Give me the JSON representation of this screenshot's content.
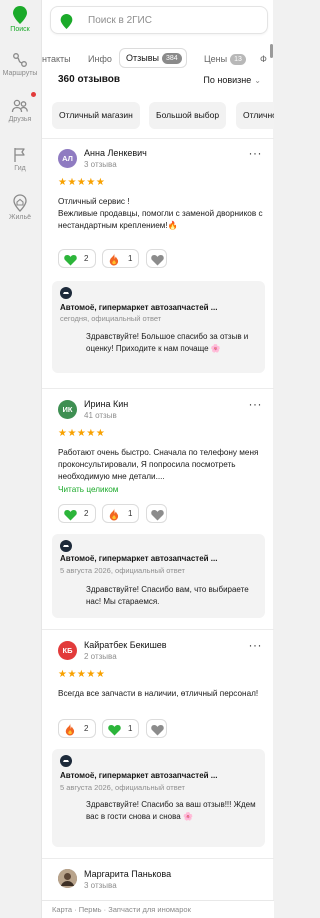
{
  "colors": {
    "brand_green": "#1baa2a",
    "star": "#f8a100",
    "notification": "#e23b3b"
  },
  "rail": {
    "items": [
      {
        "label": "Поиск",
        "icon": "pin-icon",
        "active": true
      },
      {
        "label": "Маршруты",
        "icon": "route-icon"
      },
      {
        "label": "Друзья",
        "icon": "friends-icon",
        "has_dot": true
      },
      {
        "label": "Гид",
        "icon": "flag-icon"
      },
      {
        "label": "Жильё",
        "icon": "housing-icon"
      }
    ]
  },
  "search": {
    "placeholder": "Поиск в 2ГИС"
  },
  "tabs": {
    "items": [
      {
        "label": "нтакты"
      },
      {
        "label": "Инфо"
      },
      {
        "label": "Отзывы",
        "badge": "384",
        "active": true
      },
      {
        "label": "Цены",
        "badge": "13"
      },
      {
        "label": "Ф"
      }
    ]
  },
  "reviews_header": {
    "count": "360 отзывов",
    "sort": "По новизне"
  },
  "chips": [
    "Отличный магазин",
    "Большой выбор",
    "Отличное"
  ],
  "reviews": [
    {
      "initials": "АЛ",
      "avatar_color": "#8f7bc1",
      "name": "Анна Ленкевич",
      "reviews_count": "3 отзыва",
      "stars": "★★★★★",
      "text": "Отличный сервис !\nВежливые продавцы, помогли с заменой дворников с нестандартным креплением!🔥",
      "reactions": [
        {
          "emoji": "heart-green",
          "count": "2"
        },
        {
          "emoji": "fire",
          "count": "1"
        },
        {
          "emoji": "heart-grey"
        }
      ],
      "reply": {
        "org": "Автомоё, гипермаркет автозапчастей ...",
        "date": "сегодня, официальный ответ",
        "text": "Здравствуйте! Большое спасибо за отзыв и оценку! Приходите к нам почаще 🌸"
      }
    },
    {
      "initials": "ИК",
      "avatar_color": "#3e8f52",
      "name": "Ирина Кин",
      "reviews_count": "41 отзыв",
      "stars": "★★★★★",
      "text": "Работают очень быстро. Сначала по телефону меня проконсультировали, Я попросила посмотреть необходимую мне детали....",
      "read_more": "Читать целиком",
      "reactions": [
        {
          "emoji": "heart-green",
          "count": "2"
        },
        {
          "emoji": "fire",
          "count": "1"
        },
        {
          "emoji": "heart-grey"
        }
      ],
      "reply": {
        "org": "Автомоё, гипермаркет автозапчастей ...",
        "date": "5 августа 2026, официальный ответ",
        "text": "Здравствуйте! Спасибо вам, что выбираете нас! Мы стараемся."
      }
    },
    {
      "initials": "КБ",
      "avatar_color": "#e23b3b",
      "name": "Кайратбек Бекишев",
      "reviews_count": "2 отзыва",
      "stars": "★★★★★",
      "text": "Всегда все запчасти в наличии, өтличный персонал!",
      "reactions": [
        {
          "emoji": "fire",
          "count": "2"
        },
        {
          "emoji": "heart-green",
          "count": "1"
        },
        {
          "emoji": "heart-grey"
        }
      ],
      "reply": {
        "org": "Автомоё, гипермаркет автозапчастей ...",
        "date": "5 августа 2026, официальный ответ",
        "text": "Здравствуйте! Спасибо за ваш отзыв!!! Ждем вас в гости снова и снова 🌸"
      }
    },
    {
      "initials": "",
      "avatar_color": "#8a7a6a",
      "name": "Маргарита Панькова",
      "reviews_count": "3 отзыва"
    }
  ],
  "footer": "Карта · Пермь · Запчасти для иномарок"
}
